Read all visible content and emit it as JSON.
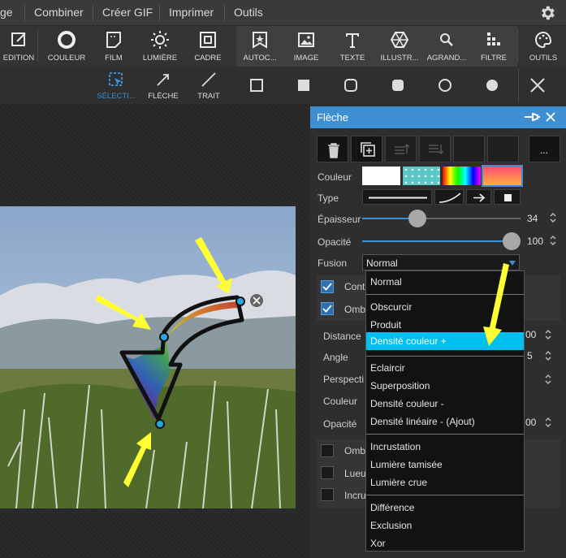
{
  "menubar": {
    "items": [
      "ge",
      "Combiner",
      "Créer GIF",
      "Imprimer",
      "Outils"
    ],
    "settings_icon": "gear-icon"
  },
  "toolbar": {
    "items": [
      {
        "label": "EDITION",
        "icon": "edit-icon"
      },
      {
        "label": "COULEUR",
        "icon": "color-circle-icon"
      },
      {
        "label": "FILM",
        "icon": "film-icon"
      },
      {
        "label": "LUMIÈRE",
        "icon": "sun-icon"
      },
      {
        "label": "CADRE",
        "icon": "frame-icon"
      },
      {
        "label": "AUTOC...",
        "icon": "star-badge-icon"
      },
      {
        "label": "IMAGE",
        "icon": "image-icon"
      },
      {
        "label": "TEXTE",
        "icon": "text-icon"
      },
      {
        "label": "ILLUSTR...",
        "icon": "illustration-icon"
      },
      {
        "label": "AGRAND...",
        "icon": "zoom-icon"
      },
      {
        "label": "FILTRE",
        "icon": "filter-icon"
      },
      {
        "label": "OUTILS",
        "icon": "palette-icon"
      }
    ]
  },
  "subbar": {
    "items": [
      {
        "label": "SÉLECTI...",
        "icon": "selection-icon",
        "active": true
      },
      {
        "label": "FLÈCHE",
        "icon": "arrow-icon"
      },
      {
        "label": "TRAIT",
        "icon": "line-icon"
      }
    ],
    "shapes": [
      "square-outline-icon",
      "square-filled-icon",
      "rounded-square-outline-icon",
      "rounded-square-filled-icon",
      "circle-outline-icon",
      "circle-filled-icon"
    ],
    "close_icon": "close-icon"
  },
  "panel": {
    "title": "Flèche",
    "more_label": "...",
    "couleur_label": "Couleur",
    "type_label": "Type",
    "epaisseur_label": "Épaisseur",
    "epaisseur_value": "34",
    "epaisseur_fraction": 0.34,
    "opacite_label": "Opacité",
    "opacite_value": "100",
    "fusion_label": "Fusion",
    "fusion_value": "Normal",
    "rows": [
      {
        "label": "Cont",
        "checked": true
      },
      {
        "label": "Omb",
        "checked": true
      }
    ],
    "distance_label": "Distance",
    "distance_value": "00",
    "angle_label": "Angle",
    "angle_value": "5",
    "perspective_label": "Perspecti",
    "couleur2_label": "Couleur",
    "opacite2_label": "Opacité",
    "opacite2_value": "00",
    "rows2": [
      {
        "label": "Omb",
        "checked": false
      },
      {
        "label": "Lueu",
        "checked": false
      },
      {
        "label": "Incru",
        "checked": false
      }
    ]
  },
  "dropdown": {
    "groups": [
      [
        "Normal"
      ],
      [
        "Obscurcir",
        "Produit",
        "Densité couleur +"
      ],
      [
        "Eclaircir",
        "Superposition",
        "Densité couleur -",
        "Densité linéaire - (Ajout)"
      ],
      [
        "Incrustation",
        "Lumière tamisée",
        "Lumière crue"
      ],
      [
        "Différence",
        "Exclusion",
        "Xor"
      ]
    ],
    "selected": "Densité couleur +"
  },
  "colors": {
    "accent": "#3d8fd1",
    "selected": "#00bfee",
    "annotation": "#ffff33"
  }
}
